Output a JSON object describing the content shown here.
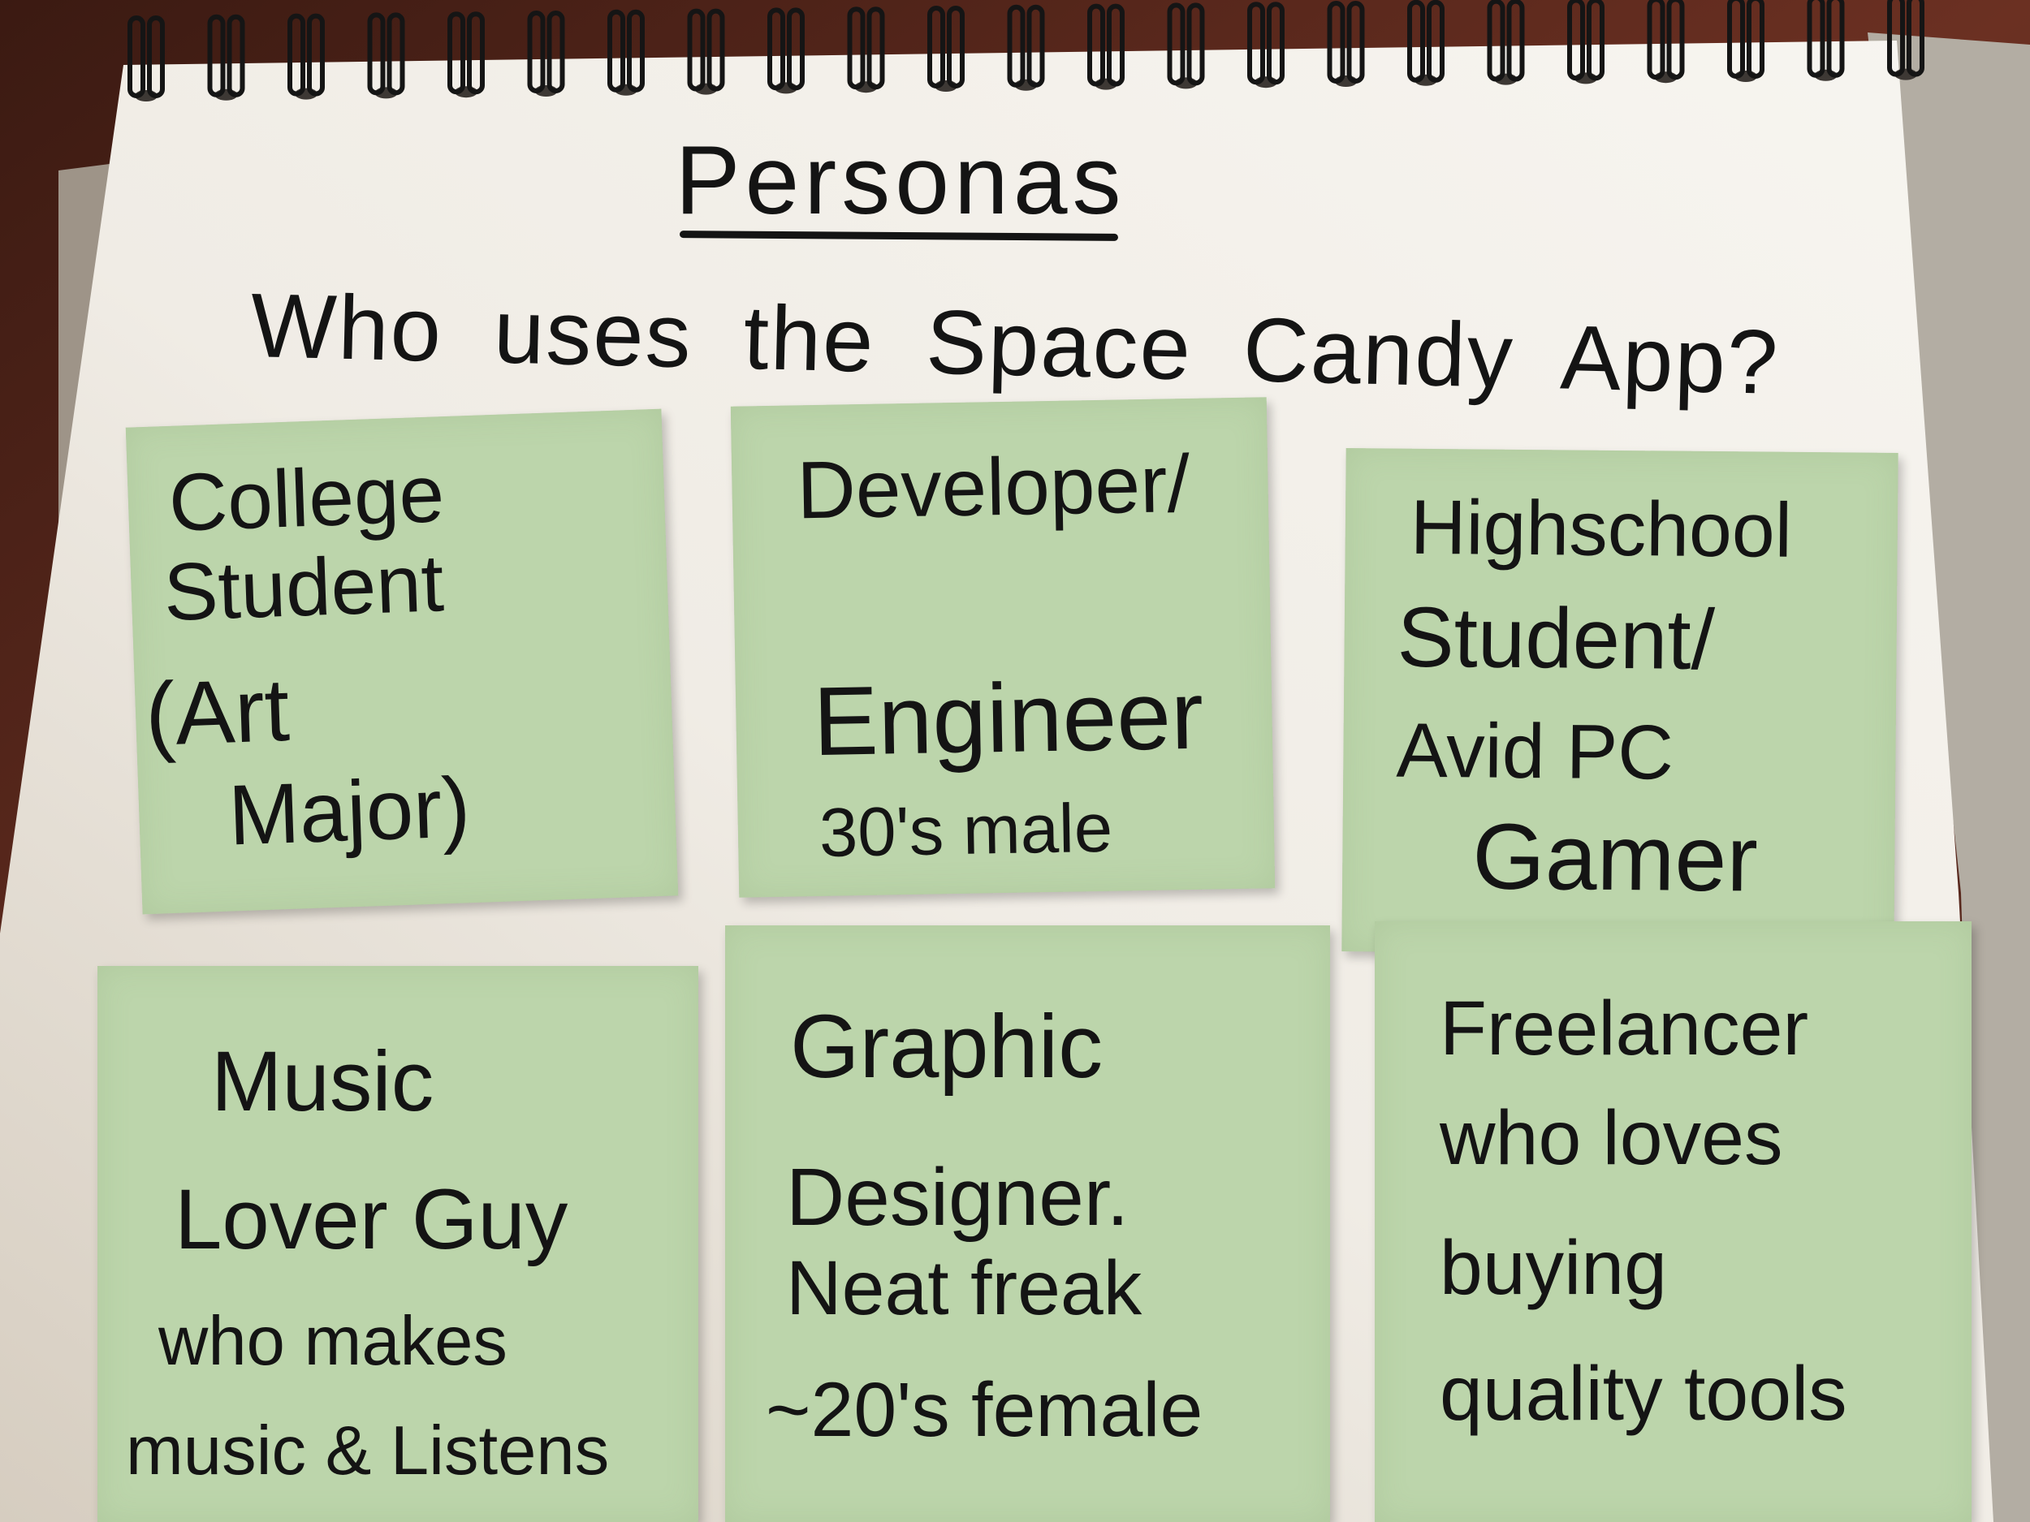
{
  "header": {
    "title": "Personas",
    "question": "Who uses the Space Candy App?"
  },
  "personas": [
    {
      "lines": [
        "College",
        "Student",
        "(Art",
        "Major)"
      ]
    },
    {
      "lines": [
        "Developer/",
        "Engineer",
        "30's male"
      ]
    },
    {
      "lines": [
        "Highschool",
        "Student/",
        "Avid PC",
        "Gamer"
      ]
    },
    {
      "lines": [
        "Music",
        "Lover Guy",
        "who makes",
        "music & Listens"
      ]
    },
    {
      "lines": [
        "Graphic",
        "Designer.",
        "Neat freak",
        "~20's female"
      ]
    },
    {
      "lines": [
        "Freelancer",
        "who loves",
        "buying",
        "quality tools"
      ]
    }
  ],
  "colors": {
    "sticky_note": "#bcd5ab",
    "paper": "#f2efe9",
    "ink": "#141414",
    "table": "#5a2b1f"
  }
}
